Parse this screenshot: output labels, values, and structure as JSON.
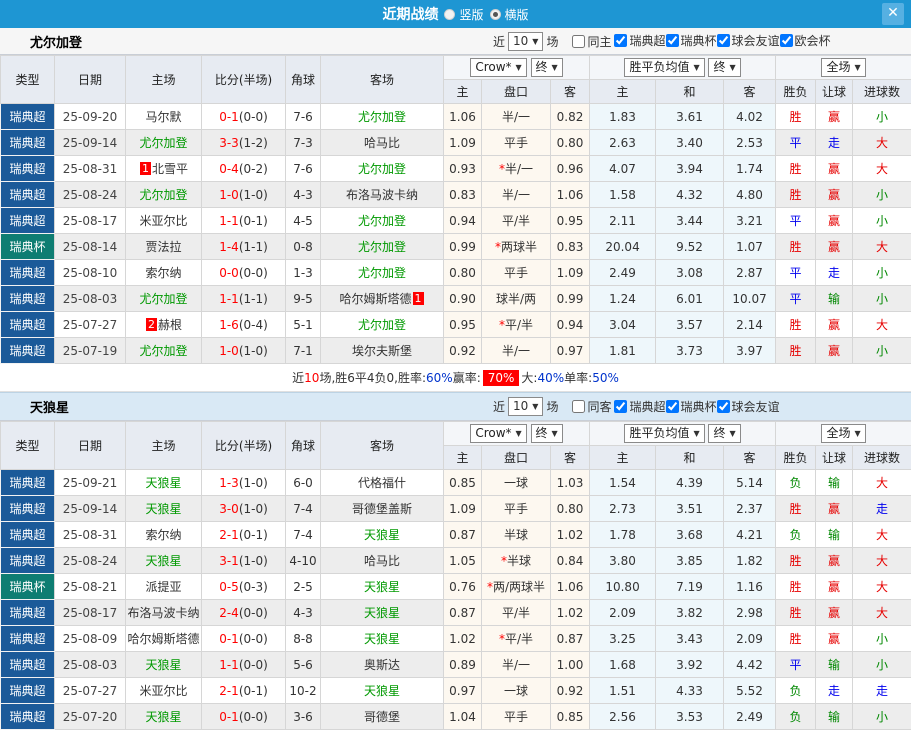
{
  "titlebar": {
    "title": "近期战绩",
    "radio_vertical": "竖版",
    "radio_horizontal": "横版",
    "selected_layout": "横版"
  },
  "colors": {
    "titlebar_blue": "#1E96D3",
    "league_navy": "#1B5A99",
    "cup_teal": "#0E7D72",
    "win_red": "#E60000",
    "draw_blue": "#0000EE",
    "lose_green": "#008800",
    "highlight_bg": "#FF0000",
    "green_team": "#009900"
  },
  "columns": {
    "type": "类型",
    "date": "日期",
    "home": "主场",
    "score": "比分(半场)",
    "corner": "角球",
    "away": "客场",
    "ah_home": "主",
    "ah_line": "盘口",
    "ah_away": "客",
    "eu_home": "主",
    "eu_draw": "和",
    "eu_away": "客",
    "res_wdl": "胜负",
    "res_handicap": "让球",
    "res_goals": "进球数"
  },
  "dropdowns": {
    "bookmaker": "Crow*",
    "final_a": "终",
    "wdl_avg": "胜平负均值",
    "final_b": "终",
    "scope": "全场"
  },
  "filter_labels": {
    "recent_pre": "近",
    "recent_post": "场"
  },
  "sections": [
    {
      "team": "尤尔加登",
      "filter": {
        "recent_value": "10",
        "same_label": "同主",
        "same_checked": false,
        "leagues": [
          {
            "label": "瑞典超",
            "checked": true
          },
          {
            "label": "瑞典杯",
            "checked": true
          },
          {
            "label": "球会友谊",
            "checked": true
          },
          {
            "label": "欧会杯",
            "checked": true
          }
        ]
      },
      "rows": [
        {
          "type": "瑞典超",
          "cup": false,
          "date": "25-09-20",
          "home": "马尔默",
          "home_green": false,
          "home_badge_pre": "",
          "home_badge_post": "",
          "score": "0-1",
          "half": "(0-0)",
          "corner": "7-6",
          "away": "尤尔加登",
          "away_green": true,
          "away_badge_pre": "",
          "away_badge_post": "",
          "ah": [
            "1.06",
            "半/一",
            "0.82"
          ],
          "star": false,
          "eu": [
            "1.83",
            "3.61",
            "4.02"
          ],
          "res": [
            [
              "胜",
              "r"
            ],
            [
              "赢",
              "r"
            ],
            [
              "小",
              "g"
            ]
          ]
        },
        {
          "type": "瑞典超",
          "cup": false,
          "date": "25-09-14",
          "home": "尤尔加登",
          "home_green": true,
          "home_badge_pre": "",
          "home_badge_post": "",
          "score": "3-3",
          "half": "(1-2)",
          "corner": "7-3",
          "away": "哈马比",
          "away_green": false,
          "away_badge_pre": "",
          "away_badge_post": "",
          "ah": [
            "1.09",
            "平手",
            "0.80"
          ],
          "star": false,
          "eu": [
            "2.63",
            "3.40",
            "2.53"
          ],
          "res": [
            [
              "平",
              "b"
            ],
            [
              "走",
              "b"
            ],
            [
              "大",
              "r"
            ]
          ]
        },
        {
          "type": "瑞典超",
          "cup": false,
          "date": "25-08-31",
          "home": "北雪平",
          "home_green": false,
          "home_badge_pre": "1",
          "home_badge_post": "",
          "score": "0-4",
          "half": "(0-2)",
          "corner": "7-6",
          "away": "尤尔加登",
          "away_green": true,
          "away_badge_pre": "",
          "away_badge_post": "",
          "ah": [
            "0.93",
            "半/一",
            "0.96"
          ],
          "star": true,
          "eu": [
            "4.07",
            "3.94",
            "1.74"
          ],
          "res": [
            [
              "胜",
              "r"
            ],
            [
              "赢",
              "r"
            ],
            [
              "大",
              "r"
            ]
          ]
        },
        {
          "type": "瑞典超",
          "cup": false,
          "date": "25-08-24",
          "home": "尤尔加登",
          "home_green": true,
          "home_badge_pre": "",
          "home_badge_post": "",
          "score": "1-0",
          "half": "(1-0)",
          "corner": "4-3",
          "away": "布洛马波卡纳",
          "away_green": false,
          "away_badge_pre": "",
          "away_badge_post": "",
          "ah": [
            "0.83",
            "半/一",
            "1.06"
          ],
          "star": false,
          "eu": [
            "1.58",
            "4.32",
            "4.80"
          ],
          "res": [
            [
              "胜",
              "r"
            ],
            [
              "赢",
              "r"
            ],
            [
              "小",
              "g"
            ]
          ]
        },
        {
          "type": "瑞典超",
          "cup": false,
          "date": "25-08-17",
          "home": "米亚尔比",
          "home_green": false,
          "home_badge_pre": "",
          "home_badge_post": "",
          "score": "1-1",
          "half": "(0-1)",
          "corner": "4-5",
          "away": "尤尔加登",
          "away_green": true,
          "away_badge_pre": "",
          "away_badge_post": "",
          "ah": [
            "0.94",
            "平/半",
            "0.95"
          ],
          "star": false,
          "eu": [
            "2.11",
            "3.44",
            "3.21"
          ],
          "res": [
            [
              "平",
              "b"
            ],
            [
              "赢",
              "r"
            ],
            [
              "小",
              "g"
            ]
          ]
        },
        {
          "type": "瑞典杯",
          "cup": true,
          "date": "25-08-14",
          "home": "贾法拉",
          "home_green": false,
          "home_badge_pre": "",
          "home_badge_post": "",
          "score": "1-4",
          "half": "(1-1)",
          "corner": "0-8",
          "away": "尤尔加登",
          "away_green": true,
          "away_badge_pre": "",
          "away_badge_post": "",
          "ah": [
            "0.99",
            "两球半",
            "0.83"
          ],
          "star": true,
          "eu": [
            "20.04",
            "9.52",
            "1.07"
          ],
          "res": [
            [
              "胜",
              "r"
            ],
            [
              "赢",
              "r"
            ],
            [
              "大",
              "r"
            ]
          ]
        },
        {
          "type": "瑞典超",
          "cup": false,
          "date": "25-08-10",
          "home": "索尔纳",
          "home_green": false,
          "home_badge_pre": "",
          "home_badge_post": "",
          "score": "0-0",
          "half": "(0-0)",
          "corner": "1-3",
          "away": "尤尔加登",
          "away_green": true,
          "away_badge_pre": "",
          "away_badge_post": "",
          "ah": [
            "0.80",
            "平手",
            "1.09"
          ],
          "star": false,
          "eu": [
            "2.49",
            "3.08",
            "2.87"
          ],
          "res": [
            [
              "平",
              "b"
            ],
            [
              "走",
              "b"
            ],
            [
              "小",
              "g"
            ]
          ]
        },
        {
          "type": "瑞典超",
          "cup": false,
          "date": "25-08-03",
          "home": "尤尔加登",
          "home_green": true,
          "home_badge_pre": "",
          "home_badge_post": "",
          "score": "1-1",
          "half": "(1-1)",
          "corner": "9-5",
          "away": "哈尔姆斯塔德",
          "away_green": false,
          "away_badge_pre": "",
          "away_badge_post": "1",
          "ah": [
            "0.90",
            "球半/两",
            "0.99"
          ],
          "star": false,
          "eu": [
            "1.24",
            "6.01",
            "10.07"
          ],
          "res": [
            [
              "平",
              "b"
            ],
            [
              "输",
              "g"
            ],
            [
              "小",
              "g"
            ]
          ]
        },
        {
          "type": "瑞典超",
          "cup": false,
          "date": "25-07-27",
          "home": "赫根",
          "home_green": false,
          "home_badge_pre": "2",
          "home_badge_post": "",
          "score": "1-6",
          "half": "(0-4)",
          "corner": "5-1",
          "away": "尤尔加登",
          "away_green": true,
          "away_badge_pre": "",
          "away_badge_post": "",
          "ah": [
            "0.95",
            "平/半",
            "0.94"
          ],
          "star": true,
          "eu": [
            "3.04",
            "3.57",
            "2.14"
          ],
          "res": [
            [
              "胜",
              "r"
            ],
            [
              "赢",
              "r"
            ],
            [
              "大",
              "r"
            ]
          ]
        },
        {
          "type": "瑞典超",
          "cup": false,
          "date": "25-07-19",
          "home": "尤尔加登",
          "home_green": true,
          "home_badge_pre": "",
          "home_badge_post": "",
          "score": "1-0",
          "half": "(1-0)",
          "corner": "7-1",
          "away": "埃尔夫斯堡",
          "away_green": false,
          "away_badge_pre": "",
          "away_badge_post": "",
          "ah": [
            "0.92",
            "半/一",
            "0.97"
          ],
          "star": false,
          "eu": [
            "1.81",
            "3.73",
            "3.97"
          ],
          "res": [
            [
              "胜",
              "r"
            ],
            [
              "赢",
              "r"
            ],
            [
              "小",
              "g"
            ]
          ]
        }
      ],
      "summary": [
        {
          "text": "近",
          "style": "k"
        },
        {
          "text": "10",
          "style": "r"
        },
        {
          "text": "场,胜6平4负0, ",
          "style": "k"
        },
        {
          "text": "胜率:",
          "style": "k"
        },
        {
          "text": "60%",
          "style": "b"
        },
        {
          "text": " 赢率:",
          "style": "k"
        },
        {
          "text": "70%",
          "style": "hl"
        },
        {
          "text": " 大:",
          "style": "k"
        },
        {
          "text": "40%",
          "style": "b"
        },
        {
          "text": " 单率:",
          "style": "k"
        },
        {
          "text": "50%",
          "style": "b"
        }
      ]
    },
    {
      "team": "天狼星",
      "filter": {
        "recent_value": "10",
        "same_label": "同客",
        "same_checked": false,
        "leagues": [
          {
            "label": "瑞典超",
            "checked": true
          },
          {
            "label": "瑞典杯",
            "checked": true
          },
          {
            "label": "球会友谊",
            "checked": true
          }
        ]
      },
      "rows": [
        {
          "type": "瑞典超",
          "cup": false,
          "date": "25-09-21",
          "home": "天狼星",
          "home_green": true,
          "home_badge_pre": "",
          "home_badge_post": "",
          "score": "1-3",
          "half": "(1-0)",
          "corner": "6-0",
          "away": "代格福什",
          "away_green": false,
          "away_badge_pre": "",
          "away_badge_post": "",
          "ah": [
            "0.85",
            "一球",
            "1.03"
          ],
          "star": false,
          "eu": [
            "1.54",
            "4.39",
            "5.14"
          ],
          "res": [
            [
              "负",
              "g"
            ],
            [
              "输",
              "g"
            ],
            [
              "大",
              "r"
            ]
          ]
        },
        {
          "type": "瑞典超",
          "cup": false,
          "date": "25-09-14",
          "home": "天狼星",
          "home_green": true,
          "home_badge_pre": "",
          "home_badge_post": "",
          "score": "3-0",
          "half": "(1-0)",
          "corner": "7-4",
          "away": "哥德堡盖斯",
          "away_green": false,
          "away_badge_pre": "",
          "away_badge_post": "",
          "ah": [
            "1.09",
            "平手",
            "0.80"
          ],
          "star": false,
          "eu": [
            "2.73",
            "3.51",
            "2.37"
          ],
          "res": [
            [
              "胜",
              "r"
            ],
            [
              "赢",
              "r"
            ],
            [
              "走",
              "b"
            ]
          ]
        },
        {
          "type": "瑞典超",
          "cup": false,
          "date": "25-08-31",
          "home": "索尔纳",
          "home_green": false,
          "home_badge_pre": "",
          "home_badge_post": "",
          "score": "2-1",
          "half": "(0-1)",
          "corner": "7-4",
          "away": "天狼星",
          "away_green": true,
          "away_badge_pre": "",
          "away_badge_post": "",
          "ah": [
            "0.87",
            "半球",
            "1.02"
          ],
          "star": false,
          "eu": [
            "1.78",
            "3.68",
            "4.21"
          ],
          "res": [
            [
              "负",
              "g"
            ],
            [
              "输",
              "g"
            ],
            [
              "大",
              "r"
            ]
          ]
        },
        {
          "type": "瑞典超",
          "cup": false,
          "date": "25-08-24",
          "home": "天狼星",
          "home_green": true,
          "home_badge_pre": "",
          "home_badge_post": "",
          "score": "3-1",
          "half": "(1-0)",
          "corner": "4-10",
          "away": "哈马比",
          "away_green": false,
          "away_badge_pre": "",
          "away_badge_post": "",
          "ah": [
            "1.05",
            "半球",
            "0.84"
          ],
          "star": true,
          "eu": [
            "3.80",
            "3.85",
            "1.82"
          ],
          "res": [
            [
              "胜",
              "r"
            ],
            [
              "赢",
              "r"
            ],
            [
              "大",
              "r"
            ]
          ]
        },
        {
          "type": "瑞典杯",
          "cup": true,
          "date": "25-08-21",
          "home": "派提亚",
          "home_green": false,
          "home_badge_pre": "",
          "home_badge_post": "",
          "score": "0-5",
          "half": "(0-3)",
          "corner": "2-5",
          "away": "天狼星",
          "away_green": true,
          "away_badge_pre": "",
          "away_badge_post": "",
          "ah": [
            "0.76",
            "两/两球半",
            "1.06"
          ],
          "star": true,
          "eu": [
            "10.80",
            "7.19",
            "1.16"
          ],
          "res": [
            [
              "胜",
              "r"
            ],
            [
              "赢",
              "r"
            ],
            [
              "大",
              "r"
            ]
          ]
        },
        {
          "type": "瑞典超",
          "cup": false,
          "date": "25-08-17",
          "home": "布洛马波卡纳",
          "home_green": false,
          "home_badge_pre": "",
          "home_badge_post": "",
          "score": "2-4",
          "half": "(0-0)",
          "corner": "4-3",
          "away": "天狼星",
          "away_green": true,
          "away_badge_pre": "",
          "away_badge_post": "",
          "ah": [
            "0.87",
            "平/半",
            "1.02"
          ],
          "star": false,
          "eu": [
            "2.09",
            "3.82",
            "2.98"
          ],
          "res": [
            [
              "胜",
              "r"
            ],
            [
              "赢",
              "r"
            ],
            [
              "大",
              "r"
            ]
          ]
        },
        {
          "type": "瑞典超",
          "cup": false,
          "date": "25-08-09",
          "home": "哈尔姆斯塔德",
          "home_green": false,
          "home_badge_pre": "",
          "home_badge_post": "",
          "score": "0-1",
          "half": "(0-0)",
          "corner": "8-8",
          "away": "天狼星",
          "away_green": true,
          "away_badge_pre": "",
          "away_badge_post": "",
          "ah": [
            "1.02",
            "平/半",
            "0.87"
          ],
          "star": true,
          "eu": [
            "3.25",
            "3.43",
            "2.09"
          ],
          "res": [
            [
              "胜",
              "r"
            ],
            [
              "赢",
              "r"
            ],
            [
              "小",
              "g"
            ]
          ]
        },
        {
          "type": "瑞典超",
          "cup": false,
          "date": "25-08-03",
          "home": "天狼星",
          "home_green": true,
          "home_badge_pre": "",
          "home_badge_post": "",
          "score": "1-1",
          "half": "(0-0)",
          "corner": "5-6",
          "away": "奥斯达",
          "away_green": false,
          "away_badge_pre": "",
          "away_badge_post": "",
          "ah": [
            "0.89",
            "半/一",
            "1.00"
          ],
          "star": false,
          "eu": [
            "1.68",
            "3.92",
            "4.42"
          ],
          "res": [
            [
              "平",
              "b"
            ],
            [
              "输",
              "g"
            ],
            [
              "小",
              "g"
            ]
          ]
        },
        {
          "type": "瑞典超",
          "cup": false,
          "date": "25-07-27",
          "home": "米亚尔比",
          "home_green": false,
          "home_badge_pre": "",
          "home_badge_post": "",
          "score": "2-1",
          "half": "(0-1)",
          "corner": "10-2",
          "away": "天狼星",
          "away_green": true,
          "away_badge_pre": "",
          "away_badge_post": "",
          "ah": [
            "0.97",
            "一球",
            "0.92"
          ],
          "star": false,
          "eu": [
            "1.51",
            "4.33",
            "5.52"
          ],
          "res": [
            [
              "负",
              "g"
            ],
            [
              "走",
              "b"
            ],
            [
              "走",
              "b"
            ]
          ]
        },
        {
          "type": "瑞典超",
          "cup": false,
          "date": "25-07-20",
          "home": "天狼星",
          "home_green": true,
          "home_badge_pre": "",
          "home_badge_post": "",
          "score": "0-1",
          "half": "(0-0)",
          "corner": "3-6",
          "away": "哥德堡",
          "away_green": false,
          "away_badge_pre": "",
          "away_badge_post": "",
          "ah": [
            "1.04",
            "平手",
            "0.85"
          ],
          "star": false,
          "eu": [
            "2.56",
            "3.53",
            "2.49"
          ],
          "res": [
            [
              "负",
              "g"
            ],
            [
              "输",
              "g"
            ],
            [
              "小",
              "g"
            ]
          ]
        }
      ],
      "summary": null
    }
  ]
}
